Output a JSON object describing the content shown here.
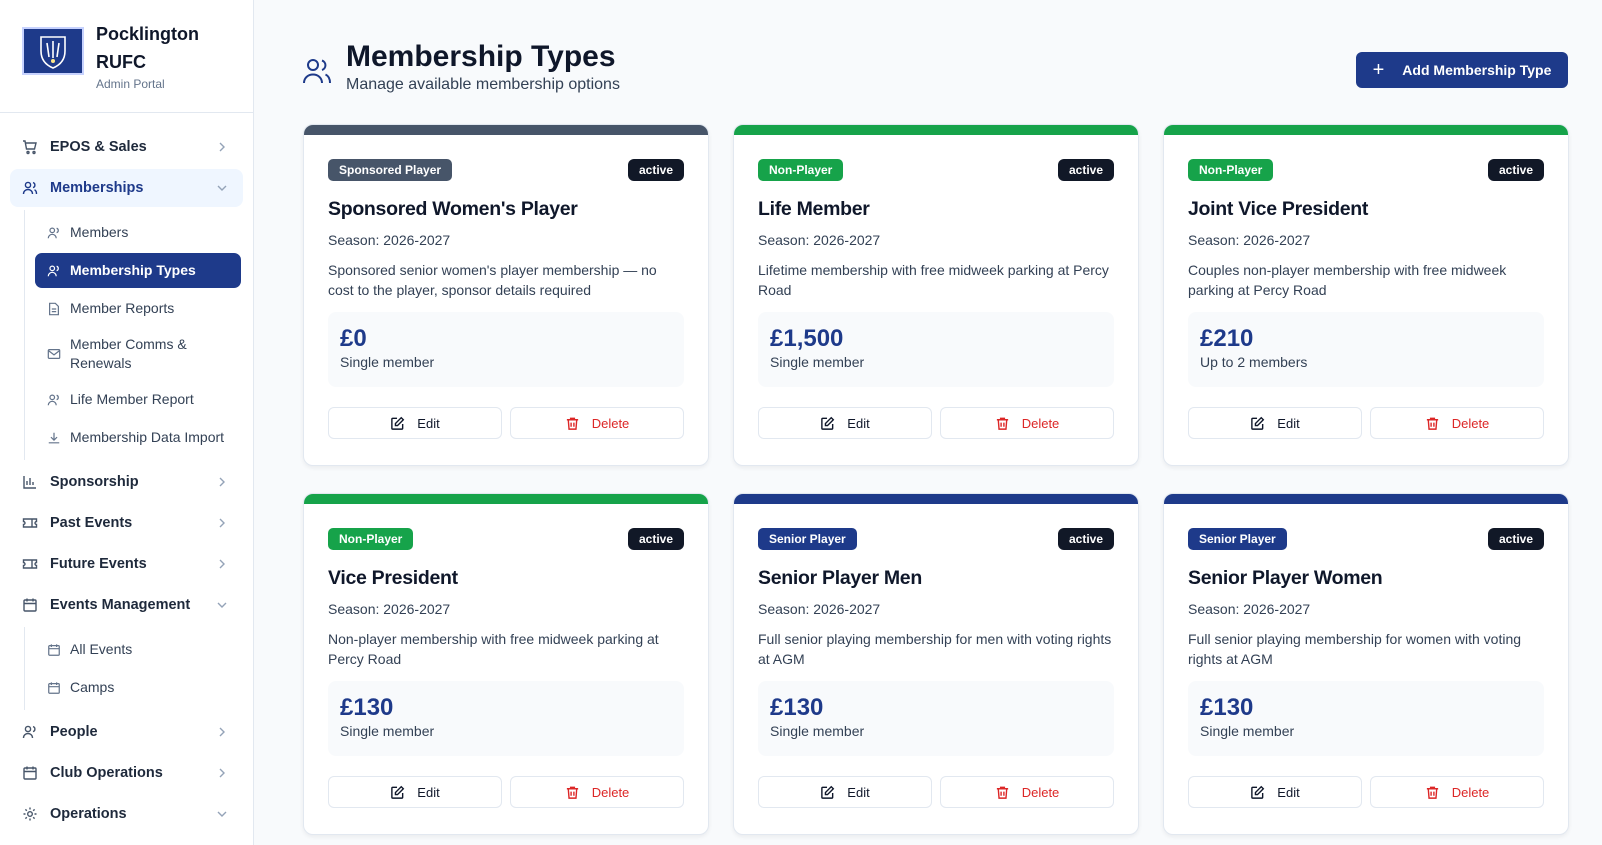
{
  "brand": {
    "name": "Pocklington RUFC",
    "subtitle": "Admin Portal"
  },
  "sidebar": {
    "items": [
      {
        "label": "EPOS & Sales",
        "icon": "cart-icon",
        "open": false
      },
      {
        "label": "Memberships",
        "icon": "users-icon",
        "open": true,
        "children": [
          {
            "label": "Members",
            "icon": "user-icon"
          },
          {
            "label": "Membership Types",
            "icon": "users-icon",
            "active": true
          },
          {
            "label": "Member Reports",
            "icon": "document-icon"
          },
          {
            "label": "Member Comms & Renewals",
            "icon": "mail-icon"
          },
          {
            "label": "Life Member Report",
            "icon": "user-icon"
          },
          {
            "label": "Membership Data Import",
            "icon": "download-icon"
          }
        ]
      },
      {
        "label": "Sponsorship",
        "icon": "bar-chart-icon",
        "open": false
      },
      {
        "label": "Past Events",
        "icon": "ticket-icon",
        "open": false
      },
      {
        "label": "Future Events",
        "icon": "ticket-icon",
        "open": false
      },
      {
        "label": "Events Management",
        "icon": "calendar-icon",
        "open": true,
        "children": [
          {
            "label": "All Events",
            "icon": "calendar-icon"
          },
          {
            "label": "Camps",
            "icon": "calendar-icon"
          }
        ]
      },
      {
        "label": "People",
        "icon": "users-icon",
        "open": false
      },
      {
        "label": "Club Operations",
        "icon": "calendar-icon",
        "open": false
      },
      {
        "label": "Operations",
        "icon": "gear-icon",
        "open": true
      }
    ]
  },
  "header": {
    "title": "Membership Types",
    "subtitle": "Manage available membership options",
    "add_button": "Add Membership Type"
  },
  "actions": {
    "edit": "Edit",
    "delete": "Delete"
  },
  "colors": {
    "primary": "#1e3a8a",
    "sponsored": "#475569",
    "non_player": "#16a34a",
    "senior_player": "#1e3a8a",
    "delete": "#dc2626"
  },
  "cards": [
    {
      "type": "Sponsored Player",
      "type_color": "#475569",
      "status": "active",
      "name": "Sponsored Women's Player",
      "season": "Season: 2026-2027",
      "description": "Sponsored senior women's player membership — no cost to the player, sponsor details required",
      "price": "£0",
      "members": "Single member"
    },
    {
      "type": "Non-Player",
      "type_color": "#16a34a",
      "status": "active",
      "name": "Life Member",
      "season": "Season: 2026-2027",
      "description": "Lifetime membership with free midweek parking at Percy Road",
      "price": "£1,500",
      "members": "Single member"
    },
    {
      "type": "Non-Player",
      "type_color": "#16a34a",
      "status": "active",
      "name": "Joint Vice President",
      "season": "Season: 2026-2027",
      "description": "Couples non-player membership with free midweek parking at Percy Road",
      "price": "£210",
      "members": "Up to 2 members"
    },
    {
      "type": "Non-Player",
      "type_color": "#16a34a",
      "status": "active",
      "name": "Vice President",
      "season": "Season: 2026-2027",
      "description": "Non-player membership with free midweek parking at Percy Road",
      "price": "£130",
      "members": "Single member"
    },
    {
      "type": "Senior Player",
      "type_color": "#1e3a8a",
      "status": "active",
      "name": "Senior Player Men",
      "season": "Season: 2026-2027",
      "description": "Full senior playing membership for men with voting rights at AGM",
      "price": "£130",
      "members": "Single member"
    },
    {
      "type": "Senior Player",
      "type_color": "#1e3a8a",
      "status": "active",
      "name": "Senior Player Women",
      "season": "Season: 2026-2027",
      "description": "Full senior playing membership for women with voting rights at AGM",
      "price": "£130",
      "members": "Single member"
    }
  ]
}
